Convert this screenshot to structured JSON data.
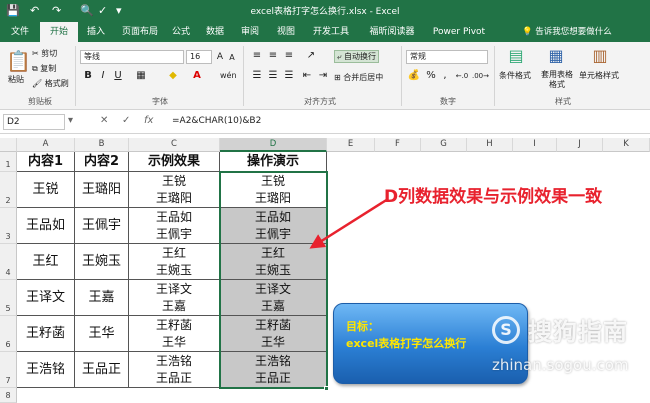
{
  "window": {
    "title": "excel表格打字怎么换行.xlsx  -  Excel"
  },
  "tabs": [
    "文件",
    "开始",
    "插入",
    "页面布局",
    "公式",
    "数据",
    "审阅",
    "视图",
    "开发工具",
    "福昕阅读器",
    "Power Pivot"
  ],
  "active_tab": "开始",
  "tell_me": "告诉我您想要做什么",
  "ribbon": {
    "clipboard": {
      "paste": "粘贴",
      "cut": "剪切",
      "copy": "复制",
      "format_painter": "格式刷",
      "label": "剪贴板"
    },
    "font": {
      "name": "等线",
      "size": "16",
      "bold": "B",
      "italic": "I",
      "underline": "U",
      "label": "字体"
    },
    "alignment": {
      "wrap_text": "自动换行",
      "merge_center": "合并后居中",
      "label": "对齐方式"
    },
    "number": {
      "format": "常规",
      "label": "数字"
    },
    "styles": {
      "conditional": "条件格式",
      "table_format": "套用表格格式",
      "cell_styles": "单元格样式",
      "label": "样式"
    }
  },
  "formula_bar": {
    "name_box": "D2",
    "formula": "=A2&CHAR(10)&B2"
  },
  "columns": [
    "A",
    "B",
    "C",
    "D",
    "E",
    "F",
    "G",
    "H",
    "I",
    "J",
    "K"
  ],
  "rows": [
    "1",
    "2",
    "3",
    "4",
    "5",
    "6",
    "7",
    "8"
  ],
  "headers": [
    "内容1",
    "内容2",
    "示例效果",
    "操作演示"
  ],
  "table": [
    {
      "a": "王锐",
      "b": "王璐阳",
      "c": [
        "王锐",
        "王璐阳"
      ],
      "d": [
        "王锐",
        "王璐阳"
      ]
    },
    {
      "a": "王品如",
      "b": "王佩宇",
      "c": [
        "王品如",
        "王佩宇"
      ],
      "d": [
        "王品如",
        "王佩宇"
      ]
    },
    {
      "a": "王红",
      "b": "王婉玉",
      "c": [
        "王红",
        "王婉玉"
      ],
      "d": [
        "王红",
        "王婉玉"
      ]
    },
    {
      "a": "王译文",
      "b": "王嘉",
      "c": [
        "王译文",
        "王嘉"
      ],
      "d": [
        "王译文",
        "王嘉"
      ]
    },
    {
      "a": "王籽菡",
      "b": "王华",
      "c": [
        "王籽菡",
        "王华"
      ],
      "d": [
        "王籽菡",
        "王华"
      ]
    },
    {
      "a": "王浩铭",
      "b": "王品正",
      "c": [
        "王浩铭",
        "王品正"
      ],
      "d": [
        "王浩铭",
        "王品正"
      ]
    }
  ],
  "annotation": "D列数据效果与示例效果一致",
  "goal_box": {
    "label": "目标：",
    "text": "excel表格打字怎么换行"
  },
  "watermark": {
    "logo": "S",
    "cn": "搜狗指南",
    "en": "zhinan.sogou.com"
  },
  "colors": {
    "excel_green": "#217346",
    "annotation_red": "#e8222e",
    "goal_yellow": "#ffe600"
  }
}
